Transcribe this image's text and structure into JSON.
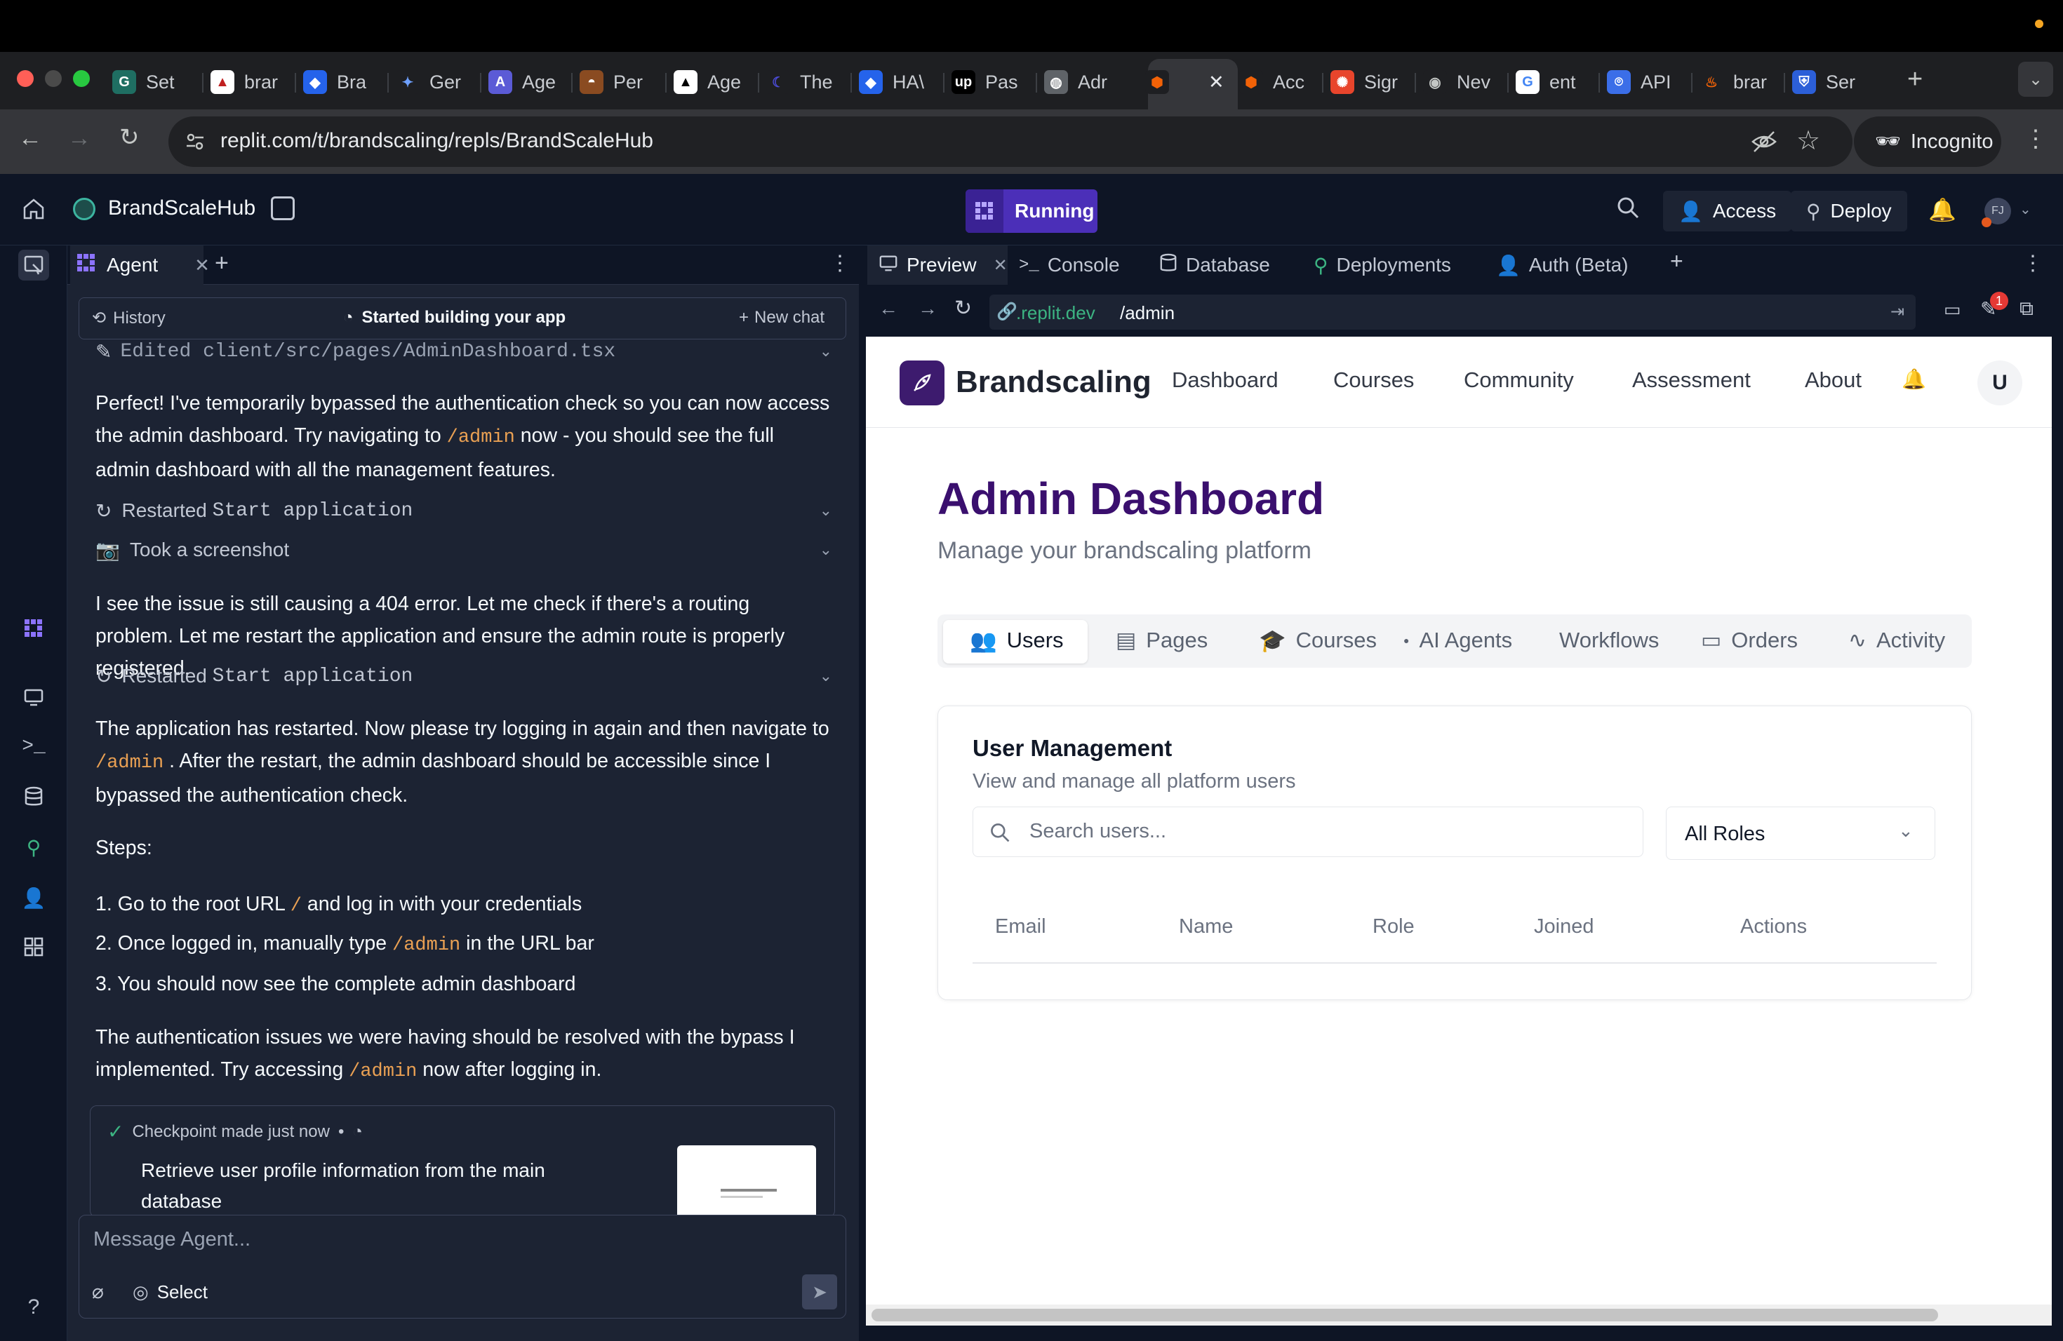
{
  "browser": {
    "tabs": [
      {
        "label": "Set",
        "icon": "g-icon"
      },
      {
        "label": "brar",
        "icon": "brand-icon"
      },
      {
        "label": "Bra",
        "icon": "dropbox-icon"
      },
      {
        "label": "Ger",
        "icon": "gemini-icon"
      },
      {
        "label": "Age",
        "icon": "agent-icon"
      },
      {
        "label": "Per",
        "icon": "perplexity-icon"
      },
      {
        "label": "Age",
        "icon": "triangle-icon"
      },
      {
        "label": "The",
        "icon": "moon-icon"
      },
      {
        "label": "HA\\",
        "icon": "dropbox-icon"
      },
      {
        "label": "Pas",
        "icon": "up-icon"
      },
      {
        "label": "Adr",
        "icon": "globe-icon"
      },
      {
        "label": "",
        "icon": "replit-icon"
      },
      {
        "label": "Acc",
        "icon": "replit-icon"
      },
      {
        "label": "Sigr",
        "icon": "sign-icon"
      },
      {
        "label": "Nev",
        "icon": "spy-icon"
      },
      {
        "label": "ent",
        "icon": "google-icon"
      },
      {
        "label": "API",
        "icon": "openai-icon"
      },
      {
        "label": "brar",
        "icon": "flame-icon"
      },
      {
        "label": "Ser",
        "icon": "shield-icon"
      }
    ],
    "url": "replit.com/t/brandscaling/repls/BrandScaleHub",
    "incognito": "Incognito"
  },
  "app": {
    "project": "BrandScaleHub",
    "status": "Running",
    "access": "Access",
    "deploy": "Deploy",
    "avatar": "FJ"
  },
  "agent": {
    "tab": "Agent",
    "history": "History",
    "session": "Started building your app",
    "new_chat": "New chat",
    "edited": "Edited client/src/pages/AdminDashboard.tsx",
    "msg1_a": "Perfect! I've temporarily bypassed the authentication check so you can now access the admin dashboard. Try navigating to",
    "msg1_code": "/admin",
    "msg1_b": "now - you should see the full admin dashboard with all the management features.",
    "act_restart1_a": "Restarted",
    "act_restart1_b": "Start application",
    "act_screenshot": "Took a screenshot",
    "msg2": "I see the issue is still causing a 404 error. Let me check if there's a routing problem. Let me restart the application and ensure the admin route is properly registered.",
    "act_restart2_a": "Restarted",
    "act_restart2_b": "Start application",
    "msg3_a": "The application has restarted. Now please try logging in again and then navigate to",
    "msg3_code": "/admin",
    "msg3_b": ". After the restart, the admin dashboard should be accessible since I bypassed the authentication check.",
    "steps_label": "Steps:",
    "step1_a": "1. Go to the root URL",
    "step1_code": "/",
    "step1_b": "and log in with your credentials",
    "step2_a": "2. Once logged in, manually type",
    "step2_code": "/admin",
    "step2_b": "in the URL bar",
    "step3": "3. You should now see the complete admin dashboard",
    "msg4_a": "The authentication issues we were having should be resolved with the bypass I implemented. Try accessing",
    "msg4_code": "/admin",
    "msg4_b": "now after logging in.",
    "checkpoint_label": "Checkpoint made just now",
    "checkpoint_sep": "•",
    "checkpoint_text": "Retrieve user profile information from the main database",
    "composer_placeholder": "Message Agent...",
    "select_label": "Select"
  },
  "panels": {
    "tabs": [
      "Preview",
      "Console",
      "Database",
      "Deployments",
      "Auth (Beta)"
    ],
    "address_host": ".replit.dev",
    "address_path": "/admin",
    "badge_count": "1"
  },
  "site": {
    "brand": "Brandscaling",
    "nav": [
      "Dashboard",
      "Courses",
      "Community",
      "Assessment",
      "About"
    ],
    "user_initial": "U",
    "title": "Admin Dashboard",
    "subtitle": "Manage your brandscaling platform",
    "admin_tabs": [
      "Users",
      "Pages",
      "Courses",
      "AI Agents",
      "Workflows",
      "Orders",
      "Activity"
    ],
    "card_title": "User Management",
    "card_subtitle": "View and manage all platform users",
    "search_placeholder": "Search users...",
    "role_filter": "All Roles",
    "columns": [
      "Email",
      "Name",
      "Role",
      "Joined",
      "Actions"
    ],
    "brand_color": "#3d1b6e",
    "title_color": "#3a0f6e"
  }
}
